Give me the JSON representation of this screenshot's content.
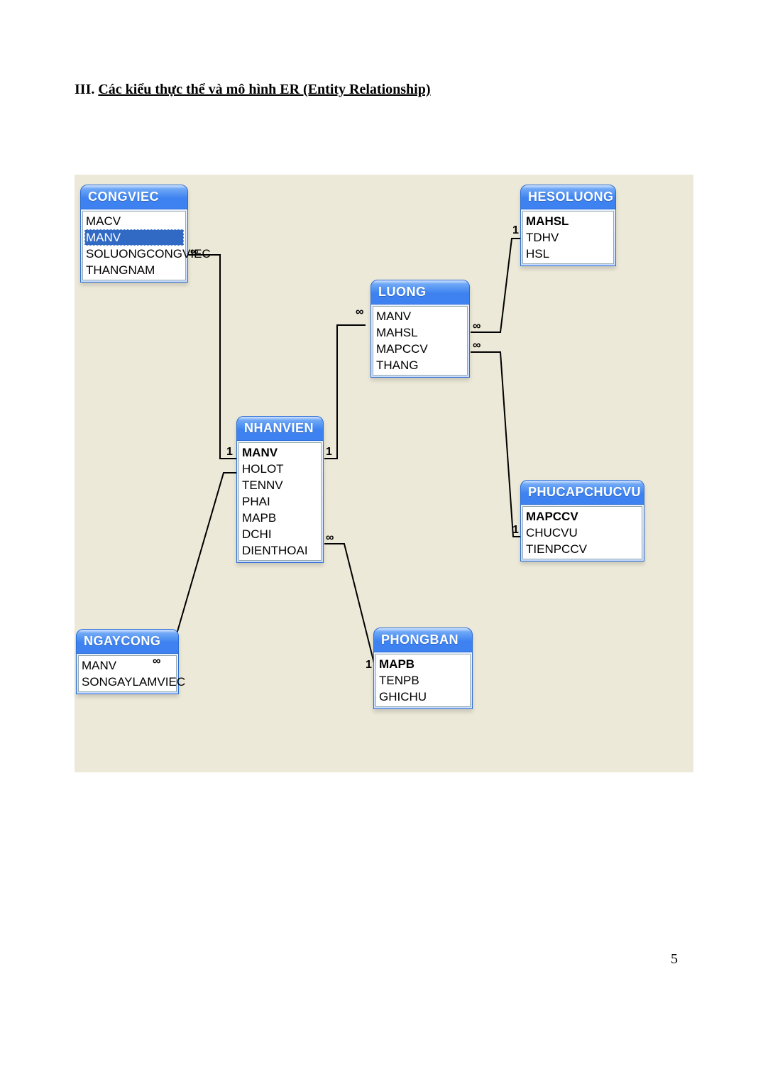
{
  "heading_roman": "III. ",
  "heading_text": "Các kiểu thực thể và mô hình ER (Entity Relationship)",
  "page_number": "5",
  "entities": {
    "congviec": {
      "title": "CONGVIEC",
      "fields": [
        "MACV",
        "MANV",
        "SOLUONGCONGVIEC",
        "THANGNAM"
      ],
      "pk_index": -1,
      "selected_index": 1
    },
    "hesoluong": {
      "title": "HESOLUONG",
      "fields": [
        "MAHSL",
        "TDHV",
        "HSL"
      ],
      "pk_index": 0,
      "selected_index": -1
    },
    "luong": {
      "title": "LUONG",
      "fields": [
        "MANV",
        "MAHSL",
        "MAPCCV",
        "THANG"
      ],
      "pk_index": -1,
      "selected_index": -1
    },
    "nhanvien": {
      "title": "NHANVIEN",
      "fields": [
        "MANV",
        "HOLOT",
        "TENNV",
        "PHAI",
        "MAPB",
        "DCHI",
        "DIENTHOAI"
      ],
      "pk_index": 0,
      "selected_index": -1
    },
    "phucapchucvu": {
      "title": "PHUCAPCHUCVU",
      "fields": [
        "MAPCCV",
        "CHUCVU",
        "TIENPCCV"
      ],
      "pk_index": 0,
      "selected_index": -1
    },
    "ngaycong": {
      "title": "NGAYCONG",
      "fields": [
        "MANV",
        "SONGAYLAMVIEC"
      ],
      "pk_index": -1,
      "selected_index": -1
    },
    "phongban": {
      "title": "PHONGBAN",
      "fields": [
        "MAPB",
        "TENPB",
        "GHICHU"
      ],
      "pk_index": 0,
      "selected_index": -1
    }
  },
  "cardinalities": {
    "cv_inf": "∞",
    "nv_left_1": "1",
    "nv_right_1": "1",
    "luong_inf": "∞",
    "luong_r1_inf": "∞",
    "luong_r2_inf": "∞",
    "hsl_1": "1",
    "pccv_1": "1",
    "nv_bot_inf": "∞",
    "pb_1": "1",
    "ng_inf": "∞"
  }
}
